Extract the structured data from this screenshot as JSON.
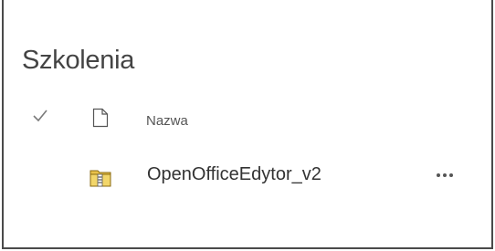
{
  "list": {
    "title": "Szkolenia",
    "column_header": "Nazwa",
    "items": [
      {
        "name": "OpenOfficeEdytor_v2",
        "icon": "zip-folder-icon"
      }
    ]
  },
  "colors": {
    "title": "#444444",
    "text": "#333333",
    "border": "#4a4a4a"
  }
}
